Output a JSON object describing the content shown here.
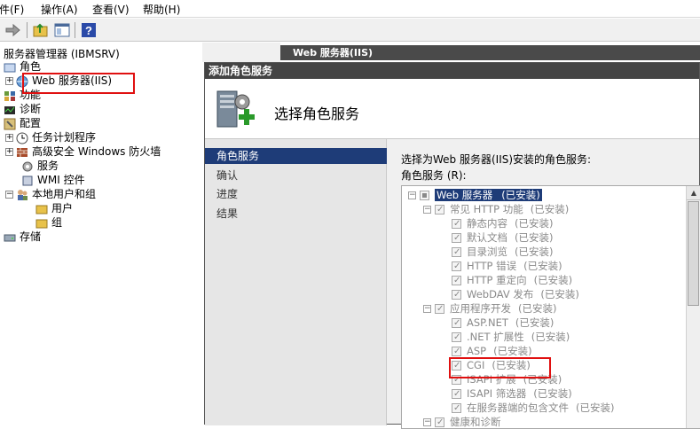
{
  "menu": {
    "file": "件(F)",
    "action": "操作(A)",
    "view": "查看(V)",
    "help": "帮助(H)"
  },
  "toolbar": {
    "icons": [
      "forward-arrow-icon",
      "folder-up-icon",
      "console-view-icon",
      "help-icon"
    ],
    "help_glyph": "?"
  },
  "tree": {
    "header": "服务器管理器 (IBMSRV)",
    "items": [
      {
        "label": "角色",
        "icon": "roles-icon"
      },
      {
        "label": "Web 服务器(IIS)",
        "icon": "web-server-icon"
      },
      {
        "label": "功能",
        "icon": "features-icon"
      },
      {
        "label": "诊断",
        "icon": "diagnostics-icon"
      },
      {
        "label": "配置",
        "icon": "configuration-icon"
      },
      {
        "label": "任务计划程序",
        "icon": "clock-icon"
      },
      {
        "label": "高级安全 Windows 防火墙",
        "icon": "firewall-icon"
      },
      {
        "label": "服务",
        "icon": "services-icon"
      },
      {
        "label": "WMI 控件",
        "icon": "wmi-icon"
      },
      {
        "label": "本地用户和组",
        "icon": "users-icon"
      },
      {
        "label": "用户",
        "icon": "folder-icon"
      },
      {
        "label": "组",
        "icon": "folder-icon"
      },
      {
        "label": "存储",
        "icon": "storage-icon"
      }
    ]
  },
  "right_header": "Web 服务器(IIS)",
  "dialog": {
    "title": "添加角色服务",
    "banner_title": "选择角色服务",
    "nav": [
      "角色服务",
      "确认",
      "进度",
      "结果"
    ],
    "prompt": "选择为Web 服务器(IIS)安装的角色服务:",
    "services_label": "角色服务 (R):",
    "services": [
      {
        "label": "Web 服务器",
        "status": "(已安装)",
        "level": 0,
        "expander": "−",
        "check": "partial",
        "selected": true
      },
      {
        "label": "常见 HTTP 功能",
        "status": "(已安装)",
        "level": 1,
        "expander": "−",
        "check": "ticked"
      },
      {
        "label": "静态内容",
        "status": "(已安装)",
        "level": 2,
        "check": "ticked"
      },
      {
        "label": "默认文档",
        "status": "(已安装)",
        "level": 2,
        "check": "ticked"
      },
      {
        "label": "目录浏览",
        "status": "(已安装)",
        "level": 2,
        "check": "ticked"
      },
      {
        "label": "HTTP 错误",
        "status": "(已安装)",
        "level": 2,
        "check": "ticked"
      },
      {
        "label": "HTTP 重定向",
        "status": "(已安装)",
        "level": 2,
        "check": "ticked"
      },
      {
        "label": "WebDAV 发布",
        "status": "(已安装)",
        "level": 2,
        "check": "ticked"
      },
      {
        "label": "应用程序开发",
        "status": "(已安装)",
        "level": 1,
        "expander": "−",
        "check": "ticked"
      },
      {
        "label": "ASP.NET",
        "status": "(已安装)",
        "level": 2,
        "check": "ticked"
      },
      {
        "label": ".NET 扩展性",
        "status": "(已安装)",
        "level": 2,
        "check": "ticked"
      },
      {
        "label": "ASP",
        "status": "(已安装)",
        "level": 2,
        "check": "ticked"
      },
      {
        "label": "CGI",
        "status": "(已安装)",
        "level": 2,
        "check": "ticked"
      },
      {
        "label": "ISAPI 扩展",
        "status": "(已安装)",
        "level": 2,
        "check": "ticked"
      },
      {
        "label": "ISAPI 筛选器",
        "status": "(已安装)",
        "level": 2,
        "check": "ticked"
      },
      {
        "label": "在服务器端的包含文件",
        "status": "(已安装)",
        "level": 2,
        "check": "ticked"
      },
      {
        "label": "健康和诊断",
        "status": "",
        "level": 1,
        "expander": "−",
        "check": "ticked"
      }
    ]
  },
  "colors": {
    "selection": "#1e3c78",
    "header_bar": "#4a4a4a",
    "highlight_box": "#e01010"
  }
}
